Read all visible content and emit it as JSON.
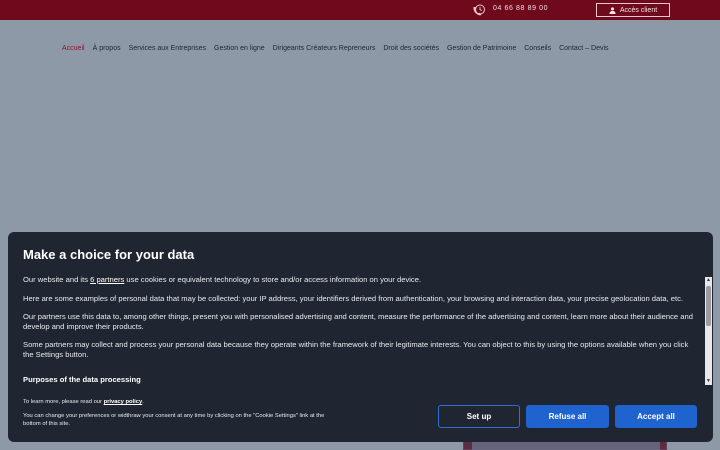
{
  "topbar": {
    "phone": "04 66 88 89 00",
    "client_label": "Accès client"
  },
  "nav": {
    "items": [
      {
        "label": "Accueil",
        "active": true
      },
      {
        "label": "À propos"
      },
      {
        "label": "Services aux Entreprises"
      },
      {
        "label": "Gestion en ligne"
      },
      {
        "label": "Dirigeants Créateurs Repreneurs"
      },
      {
        "label": "Droit des sociétés"
      },
      {
        "label": "Gestion de Patrimoine"
      },
      {
        "label": "Conseils"
      },
      {
        "label": "Contact – Devis"
      }
    ]
  },
  "modal": {
    "title": "Make a choice for your data",
    "p1_before": "Our website and its ",
    "p1_link": "6 partners",
    "p1_after": " use cookies or equivalent technology to store and/or access information on your device.",
    "p2": "Here are some examples of personal data that may be collected: your IP address, your identifiers derived from authentication, your browsing and interaction data, your precise geolocation data, etc.",
    "p3": "Our partners use this data to, among other things, present you with personalised advertising and content, measure the performance of the advertising and content, learn more about their audience and develop and improve their products.",
    "p4": "Some partners may collect and process your personal data because they operate within the framework of their legitimate interests. You can object to this by using the options available when you click the Settings button.",
    "purposes": "Purposes of the data processing",
    "privacy_before": "To learn more, please read our ",
    "privacy_link": "privacy policy",
    "privacy_after": ".",
    "change_text": "You can change your preferences or widthraw your consent at any time by clicking on the \"Cookie Settings\" link at the bottom of this site.",
    "btn_setup": "Set up",
    "btn_refuse": "Refuse all",
    "btn_accept": "Accept all"
  },
  "colors": {
    "topbar": "#6f0a1d",
    "accent": "#8b1528",
    "modal_bg": "#202631",
    "button_blue": "#1f63cf"
  }
}
